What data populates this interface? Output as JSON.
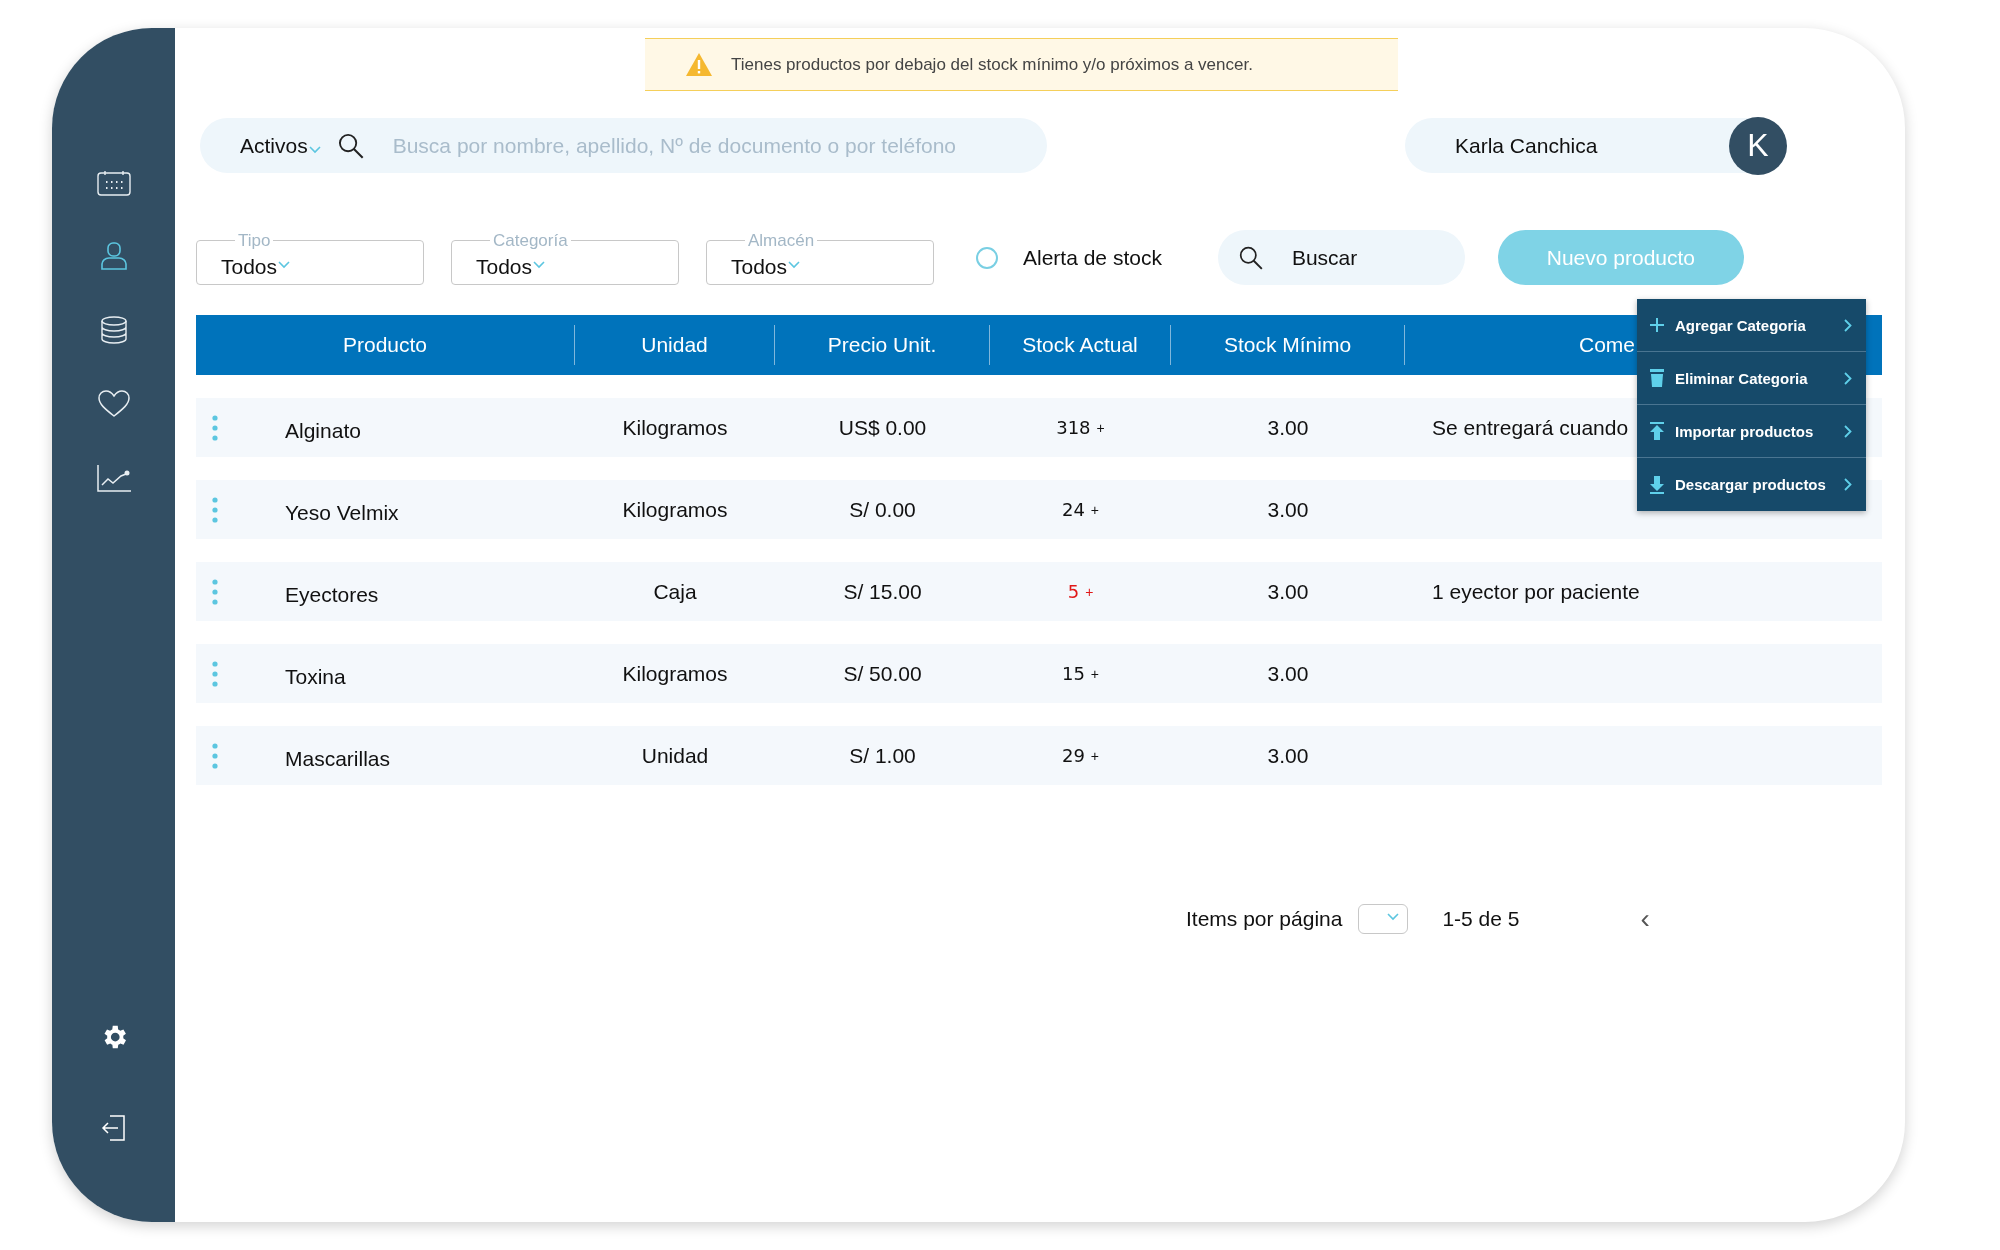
{
  "sidebar": {
    "items": [
      {
        "kind": "calendar",
        "selected": false
      },
      {
        "kind": "user",
        "selected": true
      },
      {
        "kind": "database",
        "selected": false
      },
      {
        "kind": "heart",
        "selected": false
      },
      {
        "kind": "chart",
        "selected": false
      }
    ],
    "bottom_items": [
      {
        "kind": "settings"
      },
      {
        "kind": "logout"
      }
    ]
  },
  "alert_banner": {
    "text": "Tienes productos por debajo del stock mínimo y/o próximos a vencer."
  },
  "search": {
    "filter": "Activos",
    "placeholder": "Busca por nombre, apellido, Nº de documento o por teléfono"
  },
  "user": {
    "name": "Karla Canchica",
    "initial": "K"
  },
  "filters": [
    {
      "label": "Tipo",
      "value": "Todos"
    },
    {
      "label": "Categoría",
      "value": "Todos"
    },
    {
      "label": "Almacén",
      "value": "Todos"
    }
  ],
  "stock_alert": {
    "label": "Alerta de stock",
    "checked": false
  },
  "search_button": "Buscar",
  "new_button": "Nuevo producto",
  "table": {
    "columns": [
      "Producto",
      "Unidad",
      "Precio Unit.",
      "Stock Actual",
      "Stock Mínimo",
      "Come"
    ],
    "rows": [
      {
        "product": "Alginato",
        "unit": "Kilogramos",
        "price": "US$ 0.00",
        "stock": "318",
        "add": "+",
        "low": false,
        "min": "3.00",
        "comment": "Se entregará cuando"
      },
      {
        "product": "Yeso Velmix",
        "unit": "Kilogramos",
        "price": "S/ 0.00",
        "stock": "24",
        "add": "+",
        "low": false,
        "min": "3.00"
      },
      {
        "product": "Eyectores",
        "unit": "Caja",
        "price": "S/ 15.00",
        "stock": "5",
        "add": "+",
        "low": true,
        "min": "3.00",
        "comment": "1 eyector por paciente"
      },
      {
        "product": "Toxina",
        "unit": "Kilogramos",
        "price": "S/ 50.00",
        "stock": "15",
        "add": "+",
        "low": false,
        "min": "3.00"
      },
      {
        "product": "Mascarillas",
        "unit": "Unidad",
        "price": "S/ 1.00",
        "stock": "29",
        "add": "+",
        "low": false,
        "min": "3.00"
      }
    ]
  },
  "menu": [
    {
      "kind": "add",
      "label": "Agregar Categoria"
    },
    {
      "kind": "delete",
      "label": "Eliminar Categoria"
    },
    {
      "kind": "import",
      "label": "Importar productos"
    },
    {
      "kind": "download",
      "label": "Descargar productos"
    }
  ],
  "pagination": {
    "label": "Items por página",
    "range": "1-5 de 5",
    "prev": "‹"
  }
}
